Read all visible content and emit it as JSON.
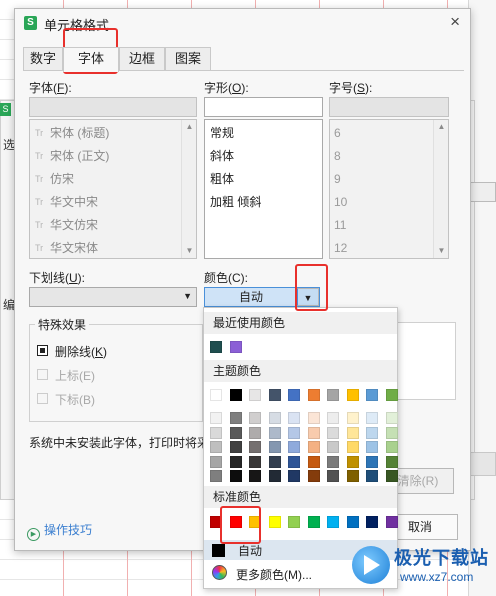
{
  "background": {
    "dialog_label_select": "选",
    "dialog_label_edit": "编"
  },
  "dialog": {
    "title": "单元格格式",
    "app_icon": "S",
    "close": "×",
    "tabs": [
      {
        "label": "数字",
        "active": false
      },
      {
        "label": "字体",
        "active": true
      },
      {
        "label": "边框",
        "active": false
      },
      {
        "label": "图案",
        "active": false
      }
    ],
    "font": {
      "label": "字体(",
      "key": "F",
      "label_tail": "):",
      "value": "",
      "items": [
        "宋体 (标题)",
        "宋体 (正文)",
        "仿宋",
        "华文中宋",
        "华文仿宋",
        "华文宋体"
      ]
    },
    "style": {
      "label": "字形(",
      "key": "O",
      "label_tail": "):",
      "value": "",
      "items": [
        "常规",
        "斜体",
        "粗体",
        "加粗 倾斜"
      ]
    },
    "size": {
      "label": "字号(",
      "key": "S",
      "label_tail": "):",
      "value": "",
      "items": [
        "6",
        "8",
        "9",
        "10",
        "11",
        "12"
      ]
    },
    "underline": {
      "label": "下划线(",
      "key": "U",
      "label_tail": "):",
      "value": ""
    },
    "color": {
      "label": "颜色(C):",
      "value": "自动"
    },
    "effects": {
      "title": "特殊效果",
      "strikethrough": {
        "label": "删除线(",
        "key": "K",
        "tail": ")",
        "checked": true
      },
      "superscript": {
        "label": "上标(E)",
        "checked": false
      },
      "subscript": {
        "label": "下标(B)",
        "checked": false
      }
    },
    "note": "系统中未安装此字体，打印时将采",
    "tips": "操作技巧",
    "clear_button": "清除(R)",
    "cancel_button": "取消"
  },
  "color_popup": {
    "recent_title": "最近使用颜色",
    "recent_colors": [
      "#1f4e4f",
      "#8b5fd6"
    ],
    "theme_title": "主题颜色",
    "theme_top": [
      "#ffffff",
      "#000000",
      "#e7e6e6",
      "#44546a",
      "#4472c4",
      "#ed7d31",
      "#a5a5a5",
      "#ffc000",
      "#5b9bd5",
      "#70ad47"
    ],
    "theme_shades": [
      [
        "#f2f2f2",
        "#7f7f7f",
        "#d0cece",
        "#d6dce4",
        "#dae3f3",
        "#fbe5d6",
        "#ededed",
        "#fff2cc",
        "#deebf7",
        "#e2f0d9"
      ],
      [
        "#d9d9d9",
        "#595959",
        "#aeabab",
        "#adb9ca",
        "#b4c7e7",
        "#f8cbad",
        "#dbdbdb",
        "#ffe699",
        "#bdd7ee",
        "#c5e0b4"
      ],
      [
        "#bfbfbf",
        "#404040",
        "#757070",
        "#8497b0",
        "#8faadc",
        "#f4b183",
        "#c9c9c9",
        "#ffd966",
        "#9dc3e6",
        "#a9d18e"
      ],
      [
        "#a6a6a6",
        "#262626",
        "#3a3838",
        "#333f50",
        "#2f5597",
        "#c55a11",
        "#7b7b7b",
        "#bf9000",
        "#2e75b6",
        "#548235"
      ],
      [
        "#7f7f7f",
        "#0d0d0d",
        "#171616",
        "#222a35",
        "#203864",
        "#843c0c",
        "#525252",
        "#7f6000",
        "#1f4e79",
        "#385723"
      ]
    ],
    "standard_title": "标准颜色",
    "standard_colors": [
      "#c00000",
      "#ff0000",
      "#ffc000",
      "#ffff00",
      "#92d050",
      "#00b050",
      "#00b0f0",
      "#0070c0",
      "#002060",
      "#7030a0"
    ],
    "auto_label": "自动",
    "more_label": "更多颜色(M)..."
  },
  "watermark": {
    "text": "极光下载站",
    "url": "www.xz7.com"
  }
}
